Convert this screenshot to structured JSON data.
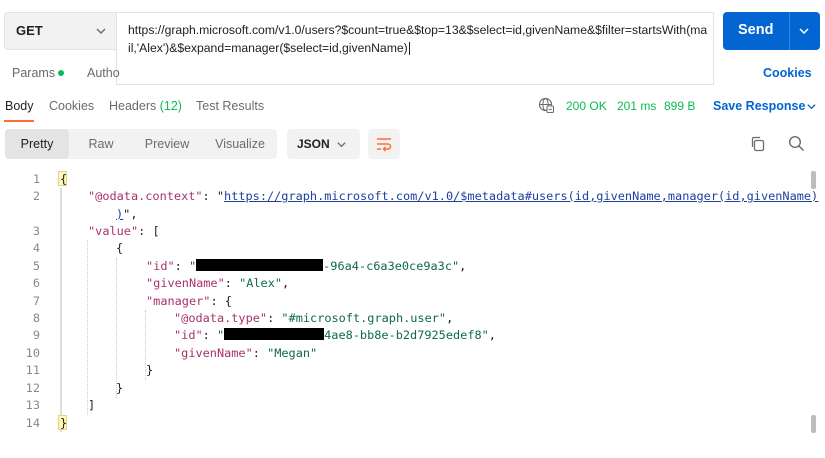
{
  "request": {
    "method": "GET",
    "url": "https://graph.microsoft.com/v1.0/users?$count=true&$top=13&$select=id,givenName&$filter=startsWith(mail,'Alex')&$expand=manager($select=id,givenName)",
    "send_label": "Send"
  },
  "request_tabs": {
    "params": "Params",
    "authorization": "Autho",
    "cookies": "Cookies"
  },
  "response_tabs": {
    "body": "Body",
    "cookies": "Cookies",
    "headers": "Headers",
    "headers_count": "(12)",
    "test_results": "Test Results"
  },
  "response_meta": {
    "status": "200 OK",
    "time": "201 ms",
    "size": "899 B",
    "save_label": "Save Response"
  },
  "view": {
    "modes": [
      "Pretty",
      "Raw",
      "Preview",
      "Visualize"
    ],
    "selected_mode": "Pretty",
    "format": "JSON"
  },
  "code": {
    "line_numbers": [
      "1",
      "2",
      "3",
      "4",
      "5",
      "6",
      "7",
      "8",
      "9",
      "10",
      "11",
      "12",
      "13",
      "14"
    ],
    "open_brace": "{",
    "close_brace": "}",
    "context_key": "\"@odata.context\"",
    "context_url_line1": "https://graph.microsoft.com/v1.0/$metadata#users(id,givenName,manager(id,givenName)",
    "context_url_line2": ")",
    "value_key": "\"value\"",
    "id_key": "\"id\"",
    "user_id_suffix": "-96a4-c6a3e0ce9a3c\"",
    "given_name_key": "\"givenName\"",
    "user_given_name": "\"Alex\"",
    "manager_key": "\"manager\"",
    "odata_type_key": "\"@odata.type\"",
    "odata_type_value": "\"#microsoft.graph.user\"",
    "manager_id_suffix": "4ae8-bb8e-b2d7925edef8\"",
    "manager_given_name": "\"Megan\""
  },
  "colors": {
    "accent": "#0265d2",
    "success": "#0cbb52",
    "tab_indicator": "#ff6c37",
    "json_key": "#a8326b",
    "json_string": "#0f6b44"
  }
}
